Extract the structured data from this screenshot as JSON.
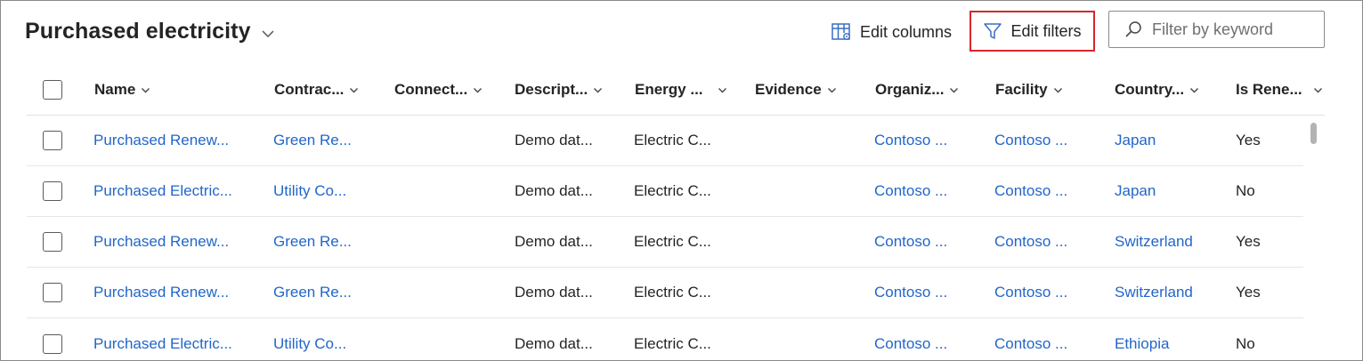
{
  "header": {
    "title": "Purchased electricity",
    "edit_columns_label": "Edit columns",
    "edit_filters_label": "Edit filters",
    "search_placeholder": "Filter by keyword"
  },
  "columns": [
    {
      "label": "Name"
    },
    {
      "label": "Contrac..."
    },
    {
      "label": "Connect..."
    },
    {
      "label": "Descript..."
    },
    {
      "label": "Energy ..."
    },
    {
      "label": "Evidence"
    },
    {
      "label": "Organiz..."
    },
    {
      "label": "Facility"
    },
    {
      "label": "Country..."
    },
    {
      "label": "Is Rene..."
    }
  ],
  "rows": [
    {
      "name": "Purchased Renew...",
      "contract": "Green Re...",
      "connection": "",
      "description": "Demo dat...",
      "energy": "Electric C...",
      "evidence": "",
      "organization": "Contoso ...",
      "facility": "Contoso ...",
      "country": "Japan",
      "renewable": "Yes"
    },
    {
      "name": "Purchased Electric...",
      "contract": "Utility Co...",
      "connection": "",
      "description": "Demo dat...",
      "energy": "Electric C...",
      "evidence": "",
      "organization": "Contoso ...",
      "facility": "Contoso ...",
      "country": "Japan",
      "renewable": "No"
    },
    {
      "name": "Purchased Renew...",
      "contract": "Green Re...",
      "connection": "",
      "description": "Demo dat...",
      "energy": "Electric C...",
      "evidence": "",
      "organization": "Contoso ...",
      "facility": "Contoso ...",
      "country": "Switzerland",
      "renewable": "Yes"
    },
    {
      "name": "Purchased Renew...",
      "contract": "Green Re...",
      "connection": "",
      "description": "Demo dat...",
      "energy": "Electric C...",
      "evidence": "",
      "organization": "Contoso ...",
      "facility": "Contoso ...",
      "country": "Switzerland",
      "renewable": "Yes"
    },
    {
      "name": "Purchased Electric...",
      "contract": "Utility Co...",
      "connection": "",
      "description": "Demo dat...",
      "energy": "Electric C...",
      "evidence": "",
      "organization": "Contoso ...",
      "facility": "Contoso ...",
      "country": "Ethiopia",
      "renewable": "No"
    }
  ],
  "colors": {
    "link": "#2266c9",
    "highlight_border": "#d9262c",
    "text": "#242424"
  },
  "icons": {
    "title_chevron": "chevron-down-icon",
    "edit_columns": "edit-columns-icon",
    "edit_filters": "filter-icon",
    "search": "search-icon",
    "column_sort": "chevron-down-icon"
  }
}
